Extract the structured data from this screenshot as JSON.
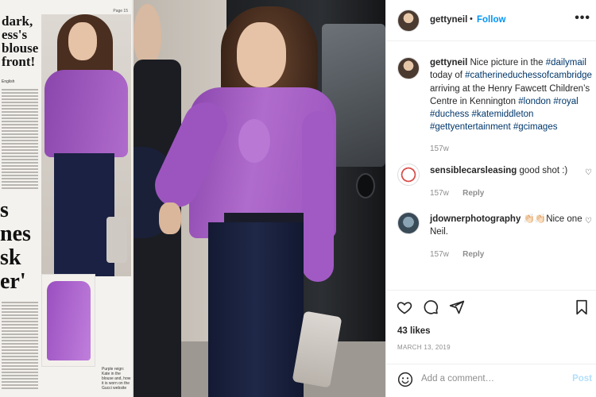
{
  "post": {
    "username": "gettyneil",
    "follow_label": "Follow",
    "header_separator": "•",
    "more_glyph": "•••",
    "caption_text_1": "Nice picture in the",
    "caption_tag_1": "#dailymail",
    "caption_text_2": "today of",
    "caption_tag_2": "#catherineduchessofcambridge",
    "caption_text_3": "arriving at the Henry Fawcett Children’s Centre in Kennington",
    "caption_tag_3": "#london",
    "caption_tag_4": "#royal",
    "caption_tag_5": "#duchess",
    "caption_tag_6": "#katemiddleton",
    "caption_tag_7": "#gettyentertainment",
    "caption_tag_8": "#gcimages",
    "caption_time": "157w",
    "likes": "43 likes",
    "date": "MARCH 13, 2019",
    "comment_placeholder": "Add a comment…",
    "post_label": "Post"
  },
  "comments": [
    {
      "username": "sensiblecarsleasing",
      "text": "good shot :)",
      "time": "157w",
      "reply_label": "Reply"
    },
    {
      "username": "jdownerphotography",
      "text": "👏🏻👏🏻Nice one Neil.",
      "time": "157w",
      "reply_label": "Reply"
    }
  ],
  "newspaper": {
    "headline": "dark, ess's blouse front!",
    "byline": "English",
    "big_text": "s nes sk er'",
    "caption": "Purple reign: Kate in the blouse and, how it is worn on the Gucci website",
    "page_number": "Page 15"
  },
  "icons": {
    "heart": "heart-icon",
    "comment": "comment-icon",
    "share": "share-icon",
    "save": "bookmark-icon",
    "emoji": "emoji-icon"
  },
  "colors": {
    "link_blue": "#0095f6",
    "hashtag": "#00376b",
    "muted": "#8e8e8e",
    "blouse_purple": "#a55bc4"
  }
}
